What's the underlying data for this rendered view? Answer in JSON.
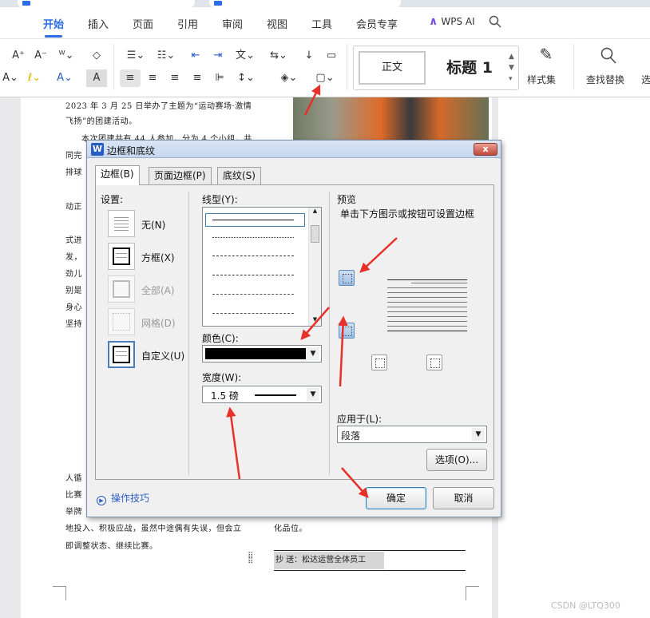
{
  "menu": {
    "tabs": [
      "开始",
      "插入",
      "页面",
      "引用",
      "审阅",
      "视图",
      "工具",
      "会员专享"
    ],
    "wps_ai": "WPS AI"
  },
  "ribbon": {
    "style_normal": "正文",
    "style_heading": "标题 1",
    "style_set": "样式集",
    "find_replace": "查找替换",
    "select_partial": "选"
  },
  "document": {
    "lines": [
      "2023 年 3 月 25 日举办了主题为“运动赛场·激情",
      "飞扬”的团建活动。",
      "本次团建共有 44 人参加，分为 4 个小组，共",
      "同完",
      "排球",
      "动正",
      "式进",
      "发，",
      "劲儿",
      "别是",
      "身心",
      "坚持",
      "人循",
      "比赛",
      "举牌",
      "地投入、积极应战，虽然中途偶有失误，但会立",
      "即调整状态、继续比赛。",
      "化品位。"
    ],
    "cc_text": "抄 送：松达运营全体员工"
  },
  "dialog": {
    "title": "边框和底纹",
    "close": "x",
    "tabs": [
      "边框(B)",
      "页面边框(P)",
      "底纹(S)"
    ],
    "settings_label": "设置:",
    "settings": [
      "无(N)",
      "方框(X)",
      "全部(A)",
      "网格(D)",
      "自定义(U)"
    ],
    "line_style_label": "线型(Y):",
    "color_label": "颜色(C):",
    "color_value": "#000000",
    "width_label": "宽度(W):",
    "width_value": "1.5   磅",
    "preview_label": "预览",
    "preview_hint": "单击下方图示或按钮可设置边框",
    "apply_label": "应用于(L):",
    "apply_value": "段落",
    "options_button": "选项(O)...",
    "tips": "操作技巧",
    "ok": "确定",
    "cancel": "取消"
  },
  "watermark": "CSDN @LTQ300",
  "colors": {
    "accent": "#2b6de5",
    "annotation_arrow": "#e8302a"
  }
}
